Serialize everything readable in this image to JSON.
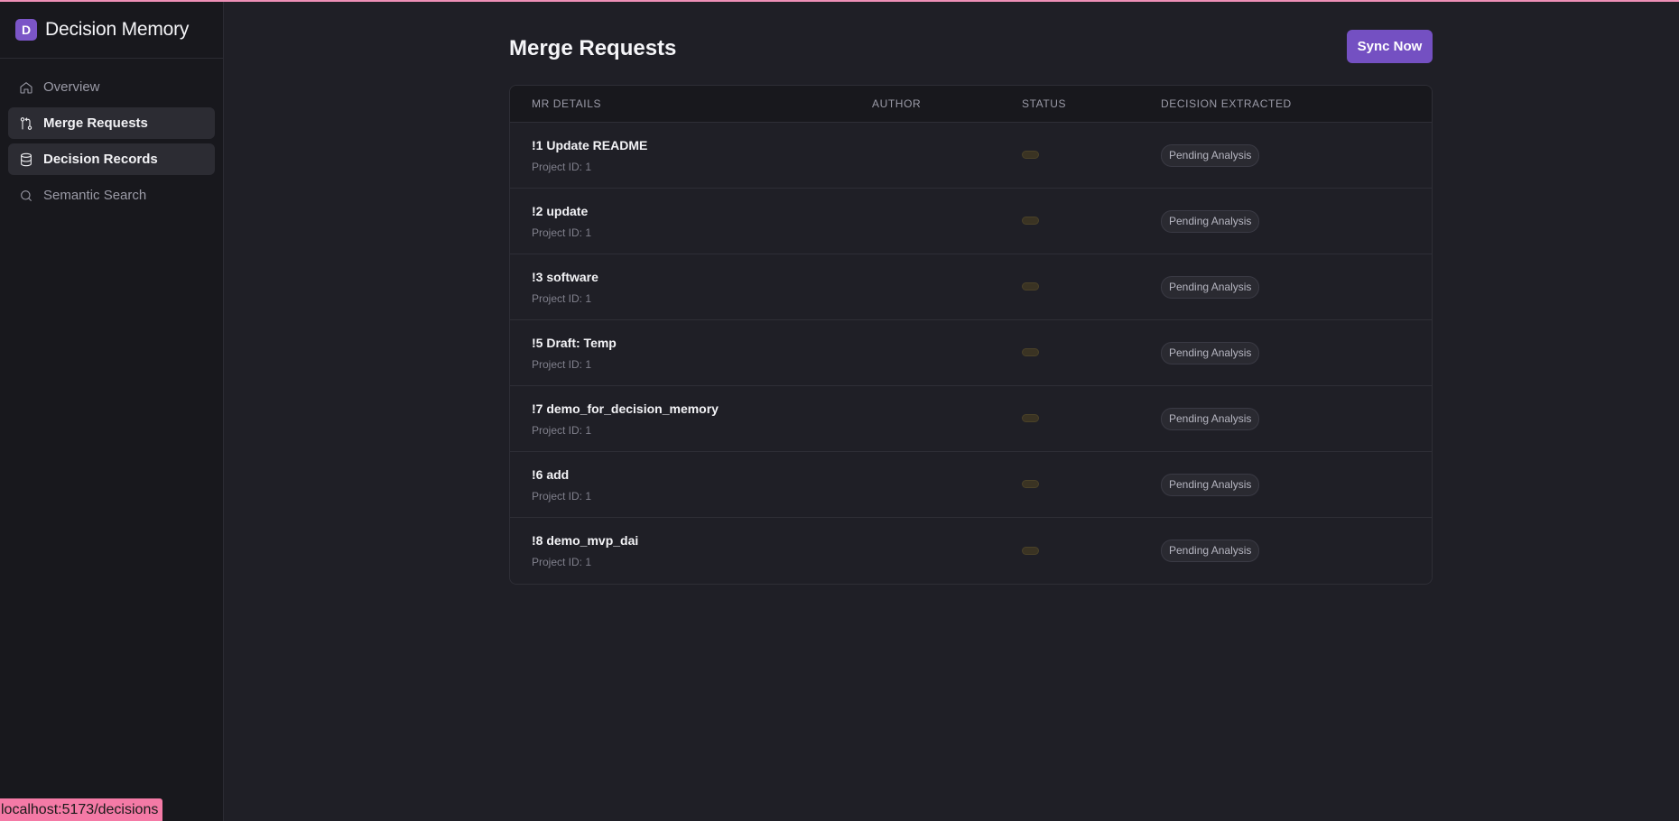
{
  "app": {
    "logo_letter": "D",
    "name": "Decision Memory"
  },
  "sidebar": {
    "items": [
      {
        "label": "Overview",
        "icon": "home-icon",
        "active": false
      },
      {
        "label": "Merge Requests",
        "icon": "git-merge-icon",
        "active": true
      },
      {
        "label": "Decision Records",
        "icon": "database-icon",
        "active": true
      },
      {
        "label": "Semantic Search",
        "icon": "search-icon",
        "active": false
      }
    ]
  },
  "page": {
    "title": "Merge Requests",
    "sync_label": "Sync Now"
  },
  "table": {
    "headers": {
      "details": "MR DETAILS",
      "author": "AUTHOR",
      "status": "STATUS",
      "decision": "DECISION EXTRACTED"
    },
    "rows": [
      {
        "title": "!1 Update README",
        "sub": "Project ID: 1",
        "author": "",
        "decision": "Pending Analysis"
      },
      {
        "title": "!2 update",
        "sub": "Project ID: 1",
        "author": "",
        "decision": "Pending Analysis"
      },
      {
        "title": "!3 software",
        "sub": "Project ID: 1",
        "author": "",
        "decision": "Pending Analysis"
      },
      {
        "title": "!5 Draft: Temp",
        "sub": "Project ID: 1",
        "author": "",
        "decision": "Pending Analysis"
      },
      {
        "title": "!7 demo_for_decision_memory",
        "sub": "Project ID: 1",
        "author": "",
        "decision": "Pending Analysis"
      },
      {
        "title": "!6 add",
        "sub": "Project ID: 1",
        "author": "",
        "decision": "Pending Analysis"
      },
      {
        "title": "!8 demo_mvp_dai",
        "sub": "Project ID: 1",
        "author": "",
        "decision": "Pending Analysis"
      }
    ]
  },
  "statusbar": {
    "url": "localhost:5173/decisions"
  },
  "colors": {
    "accent": "#7450c2",
    "status_url_bg": "#f47aa6"
  }
}
